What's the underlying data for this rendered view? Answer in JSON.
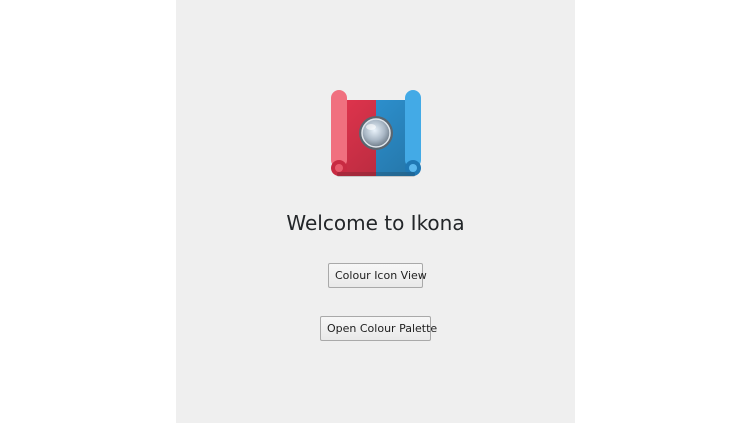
{
  "app": {
    "logo_icon": "ikona-scroll-magnifier-icon",
    "welcome_text": "Welcome to Ikona",
    "buttons": {
      "colour_icon_view": "Colour Icon View",
      "open_colour_palette": "Open Colour Palette"
    }
  },
  "colors": {
    "window_bg": "#efefef",
    "logo_red": "#e0344d",
    "logo_blue": "#2f97d8"
  }
}
